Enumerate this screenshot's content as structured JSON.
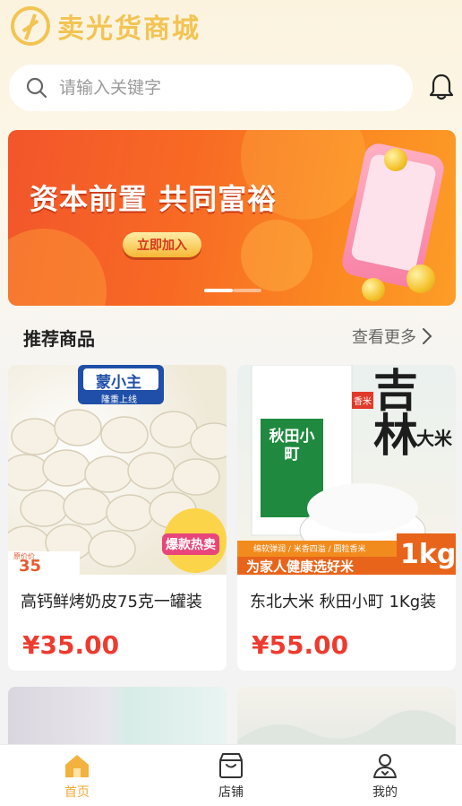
{
  "app": {
    "name": "卖光货商城"
  },
  "search": {
    "placeholder": "请输入关键字"
  },
  "banner": {
    "title": "资本前置 共同富裕",
    "button_label": "立即加入",
    "active_index": 0,
    "total": 2
  },
  "section": {
    "title": "推荐商品",
    "more_label": "查看更多"
  },
  "products": [
    {
      "name": "高钙鲜烤奶皮75克一罐装",
      "price": "¥35.00",
      "image_text": {
        "brand": "蒙小主",
        "sub": "隆重上线",
        "tag": "爆款热卖",
        "small_price": "35",
        "small_label": "原价价"
      }
    },
    {
      "name": "东北大米 秋田小町 1Kg装",
      "price": "¥55.00",
      "image_text": {
        "title": "吉林",
        "sub": "大米",
        "badge": "香米",
        "pack": "秋田小町",
        "features": "绵软弹润 / 米香四溢 / 圆粒香米",
        "slogan": "为家人健康选好米",
        "weight": "1kg"
      }
    }
  ],
  "tabbar": {
    "items": [
      {
        "label": "首页",
        "active": true
      },
      {
        "label": "店铺",
        "active": false
      },
      {
        "label": "我的",
        "active": false
      }
    ]
  },
  "colors": {
    "accent": "#f3a93a",
    "price": "#ee3b2f",
    "logo": "#f3c454",
    "banner": "#f86a24"
  }
}
